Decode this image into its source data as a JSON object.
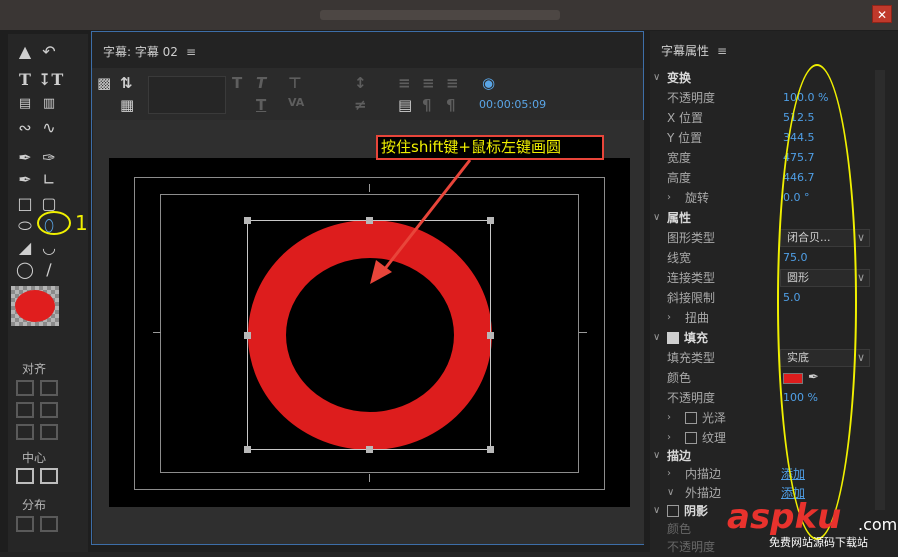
{
  "window": {
    "close_glyph": "✕"
  },
  "tools": {
    "align_label": "对齐",
    "center_label": "中心",
    "distribute_label": "分布",
    "annotation_number": "1",
    "fill_color": "#e01e1e"
  },
  "canvas": {
    "panel_title": "字幕: 字幕 02",
    "menu_glyph": "≡",
    "timecode": "00:00:05:09",
    "callout": "按住shift键+鼠标左键画圆",
    "ring_color": "#dd1d1d"
  },
  "properties": {
    "panel_title": "字幕属性",
    "menu_glyph": "≡",
    "transform": {
      "label": "变换",
      "opacity_label": "不透明度",
      "opacity_value": "100.0 %",
      "x_label": "X 位置",
      "x_value": "512.5",
      "y_label": "Y 位置",
      "y_value": "344.5",
      "width_label": "宽度",
      "width_value": "475.7",
      "height_label": "高度",
      "height_value": "446.7",
      "rotation_label": "旋转",
      "rotation_value": "0.0 °"
    },
    "attributes": {
      "label": "属性",
      "shape_type_label": "图形类型",
      "shape_type_value": "闭合贝...",
      "line_width_label": "线宽",
      "line_width_value": "75.0",
      "join_type_label": "连接类型",
      "join_type_value": "圆形",
      "miter_label": "斜接限制",
      "miter_value": "5.0",
      "distort_label": "扭曲"
    },
    "fill": {
      "label": "填充",
      "fill_type_label": "填充类型",
      "fill_type_value": "实底",
      "color_label": "颜色",
      "opacity_label": "不透明度",
      "opacity_value": "100 %",
      "sheen_label": "光泽",
      "texture_label": "纹理"
    },
    "stroke": {
      "label": "描边",
      "inner_label": "内描边",
      "inner_action": "添加",
      "outer_label": "外描边",
      "outer_action": "添加"
    },
    "shadow": {
      "label": "阴影",
      "color_label": "颜色",
      "opacity_label": "不透明度"
    }
  },
  "watermark": {
    "logo": "aspku",
    "suffix": ".com",
    "tagline": "免费网站源码下载站"
  }
}
